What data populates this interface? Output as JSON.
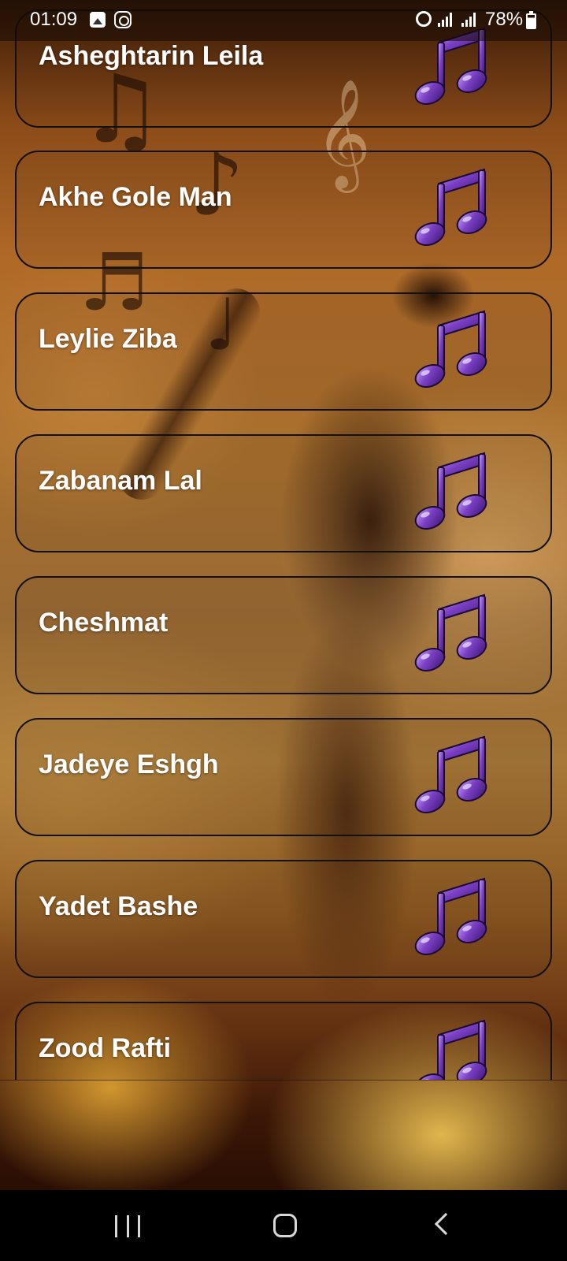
{
  "status_bar": {
    "time": "01:09",
    "battery": "78%",
    "icons": [
      "gallery-icon",
      "instagram-icon",
      "alarm-icon",
      "signal-icon",
      "signal-icon",
      "battery-icon"
    ]
  },
  "songs": [
    {
      "title": "Asheghtarin Leila",
      "icon": "music-note-icon"
    },
    {
      "title": "Akhe Gole Man",
      "icon": "music-note-icon"
    },
    {
      "title": "Leylie Ziba",
      "icon": "music-note-icon"
    },
    {
      "title": "Zabanam Lal",
      "icon": "music-note-icon"
    },
    {
      "title": "Cheshmat",
      "icon": "music-note-icon"
    },
    {
      "title": "Jadeye Eshgh",
      "icon": "music-note-icon"
    },
    {
      "title": "Yadet Bashe",
      "icon": "music-note-icon"
    },
    {
      "title": "Zood Rafti",
      "icon": "music-note-icon"
    }
  ],
  "navigation": {
    "buttons": [
      "recents-icon",
      "home-icon",
      "back-icon"
    ]
  },
  "colors": {
    "note_purple": "#7a3fc4",
    "title_text": "#ffffff",
    "card_border": "#111111"
  }
}
